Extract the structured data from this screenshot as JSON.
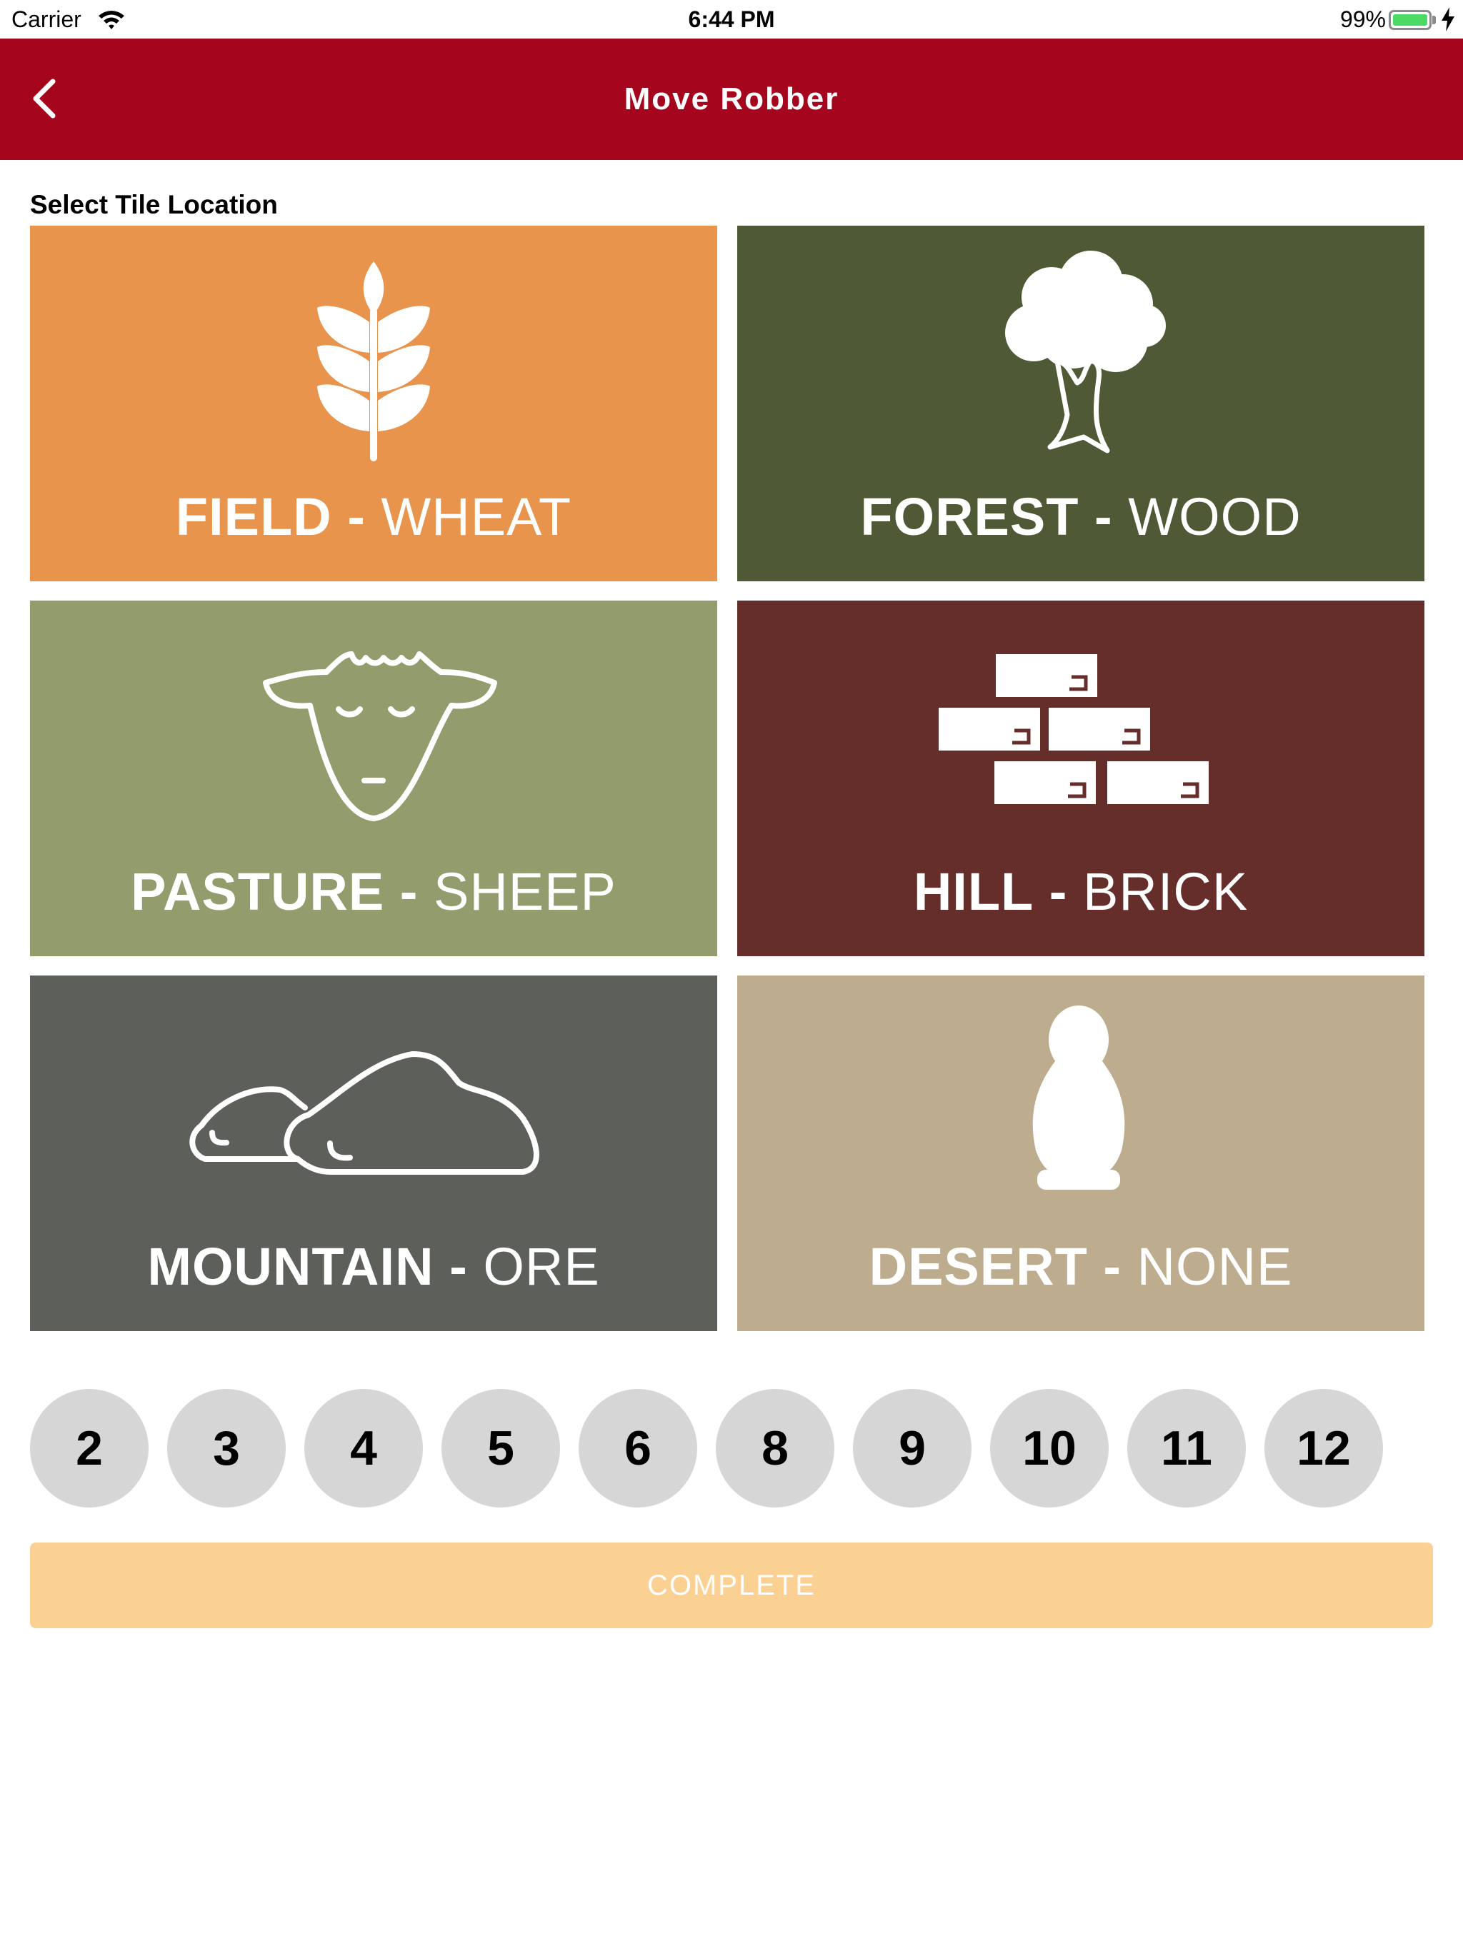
{
  "status_bar": {
    "carrier": "Carrier",
    "time": "6:44 PM",
    "battery": "99%"
  },
  "nav": {
    "title": "Move Robber"
  },
  "section_label": "Select Tile Location",
  "tiles": [
    {
      "terrain": "FIELD",
      "dash": "-",
      "resource": "WHEAT",
      "color": "#e8944c",
      "icon": "wheat-icon"
    },
    {
      "terrain": "FOREST",
      "dash": "-",
      "resource": "WOOD",
      "color": "#4f5936",
      "icon": "tree-icon"
    },
    {
      "terrain": "PASTURE",
      "dash": "-",
      "resource": "SHEEP",
      "color": "#939c6d",
      "icon": "sheep-icon"
    },
    {
      "terrain": "HILL",
      "dash": "-",
      "resource": "BRICK",
      "color": "#662e2b",
      "icon": "brick-icon"
    },
    {
      "terrain": "MOUNTAIN",
      "dash": "-",
      "resource": "ORE",
      "color": "#5d5f5b",
      "icon": "mountain-icon"
    },
    {
      "terrain": "DESERT",
      "dash": "-",
      "resource": "NONE",
      "color": "#bdac8d",
      "icon": "robber-icon"
    }
  ],
  "numbers": [
    "2",
    "3",
    "4",
    "5",
    "6",
    "8",
    "9",
    "10",
    "11",
    "12"
  ],
  "complete_label": "COMPLETE",
  "colors": {
    "nav_bar": "#a6061d",
    "number_button": "#d6d6d6",
    "complete_button": "#fbd193"
  }
}
